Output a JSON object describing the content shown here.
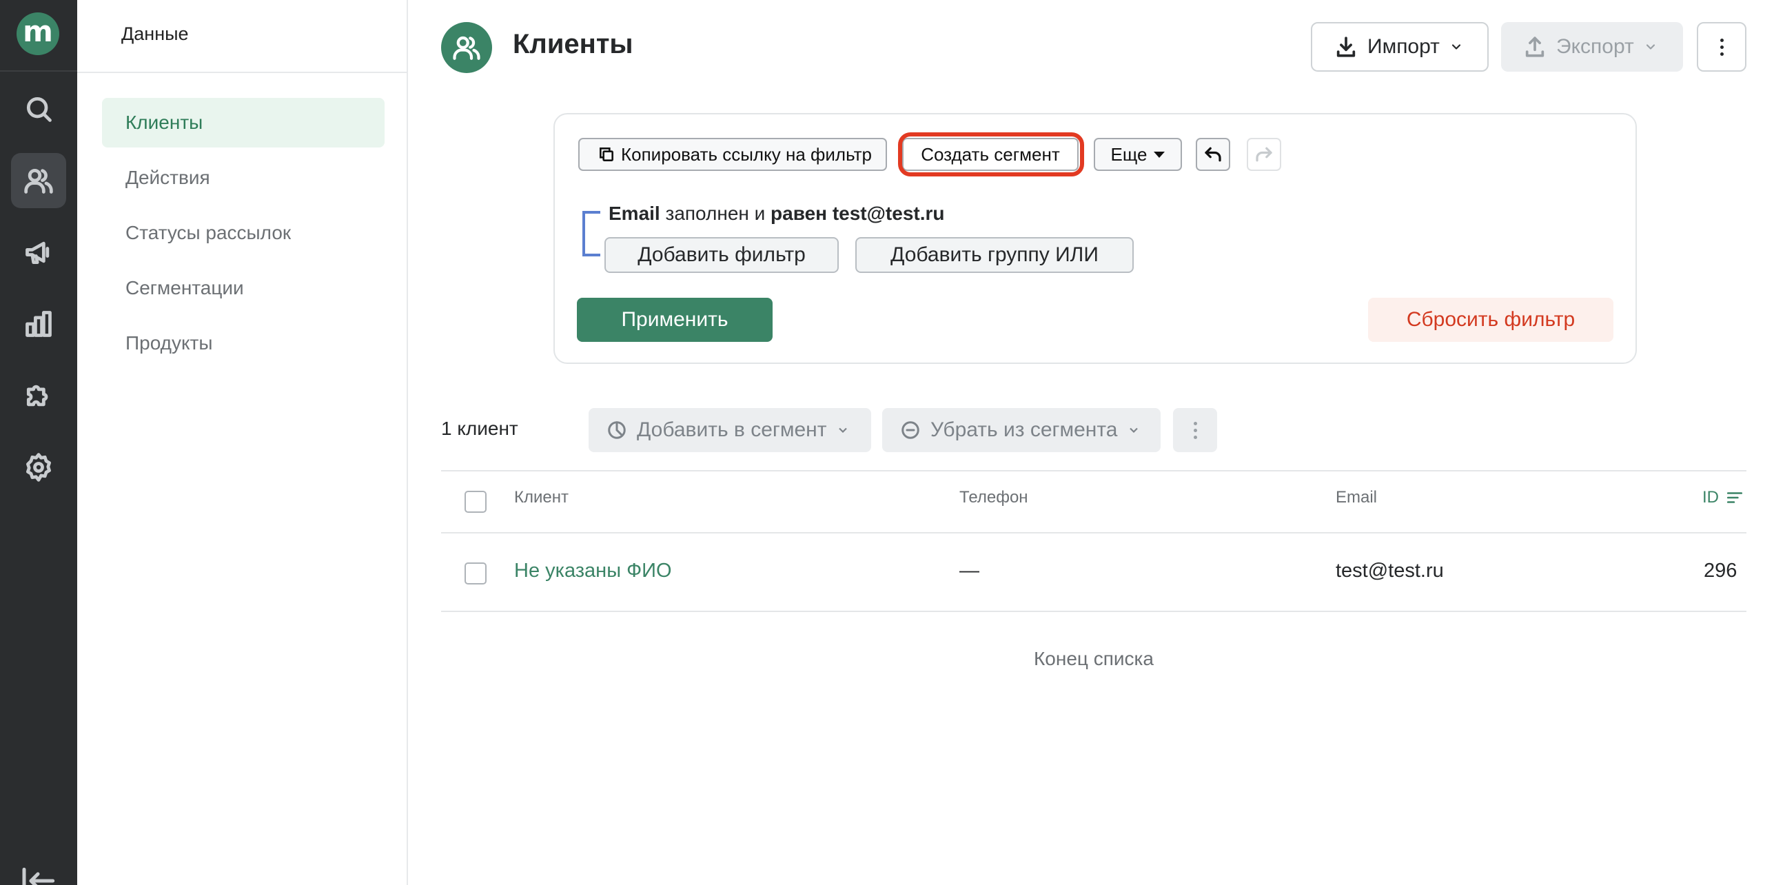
{
  "rail": {
    "logo": "m",
    "icons": [
      "search-icon",
      "users-icon",
      "megaphone-icon",
      "bar-chart-icon",
      "puzzle-icon",
      "gear-icon"
    ],
    "active": "users-icon",
    "collapse_icon": "collapse-arrow-icon"
  },
  "subnav": {
    "title": "Данные",
    "items": [
      {
        "label": "Клиенты",
        "active": true
      },
      {
        "label": "Действия",
        "active": false
      },
      {
        "label": "Статусы рассылок",
        "active": false
      },
      {
        "label": "Сегментации",
        "active": false
      },
      {
        "label": "Продукты",
        "active": false
      }
    ]
  },
  "header": {
    "title": "Клиенты",
    "import_label": "Импорт",
    "export_label": "Экспорт",
    "export_disabled": true
  },
  "filter": {
    "copy_link_label": "Копировать ссылку на фильтр",
    "create_segment_label": "Создать сегмент",
    "create_segment_highlighted": true,
    "more_label": "Еще",
    "condition": {
      "field": "Email",
      "middle": " заполнен и ",
      "operator_value": "равен test@test.ru"
    },
    "add_filter_label": "Добавить фильтр",
    "add_or_group_label": "Добавить группу ИЛИ",
    "apply_label": "Применить",
    "reset_label": "Сбросить фильтр"
  },
  "results": {
    "count_label": "1 клиент",
    "add_to_segment_label": "Добавить в сегмент",
    "remove_from_segment_label": "Убрать из сегмента"
  },
  "table": {
    "columns": [
      "Клиент",
      "Телефон",
      "Email",
      "ID"
    ],
    "sorted_column": "ID",
    "rows": [
      {
        "client": "Не указаны ФИО",
        "phone": "—",
        "email": "test@test.ru",
        "id": "296"
      }
    ],
    "end_label": "Конец списка"
  },
  "colors": {
    "brand": "#3b8466",
    "rail_bg": "#2b2d2f",
    "highlight": "#e23a22",
    "reset_text": "#d33a20",
    "condition_bracket": "#5b7fd0"
  }
}
